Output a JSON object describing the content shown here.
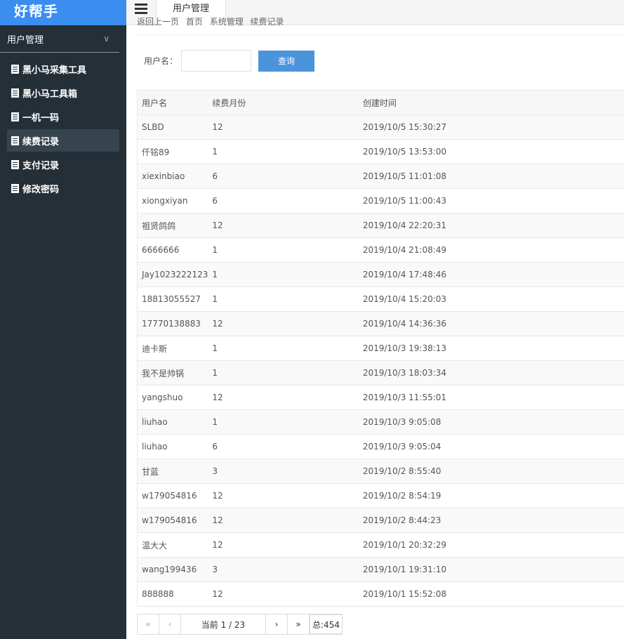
{
  "app": {
    "brand": "好帮手"
  },
  "sidebar": {
    "section_title": "用户管理",
    "items": [
      {
        "label": "黑小马采集工具",
        "active": false
      },
      {
        "label": "黑小马工具箱",
        "active": false
      },
      {
        "label": "一机一码",
        "active": false
      },
      {
        "label": "续费记录",
        "active": true
      },
      {
        "label": "支付记录",
        "active": false
      },
      {
        "label": "修改密码",
        "active": false
      }
    ]
  },
  "topbar": {
    "tab_label": "用户管理"
  },
  "breadcrumb": [
    "返回上一页",
    "首页",
    "系统管理",
    "续费记录"
  ],
  "search": {
    "label": "用户名：",
    "value": "",
    "placeholder": "",
    "button_label": "查询"
  },
  "table": {
    "headers": [
      "用户名",
      "续费月份",
      "创建时间"
    ],
    "rows": [
      [
        "SLBD",
        "12",
        "2019/10/5 15:30:27"
      ],
      [
        "仟铭89",
        "1",
        "2019/10/5 13:53:00"
      ],
      [
        "xiexinbiao",
        "6",
        "2019/10/5 11:01:08"
      ],
      [
        "xiongxiyan",
        "6",
        "2019/10/5 11:00:43"
      ],
      [
        "祖贤鸽鸽",
        "12",
        "2019/10/4 22:20:31"
      ],
      [
        "6666666",
        "1",
        "2019/10/4 21:08:49"
      ],
      [
        "Jay1023222123",
        "1",
        "2019/10/4 17:48:46"
      ],
      [
        "18813055527",
        "1",
        "2019/10/4 15:20:03"
      ],
      [
        "17770138883",
        "12",
        "2019/10/4 14:36:36"
      ],
      [
        "迪卡斯",
        "1",
        "2019/10/3 19:38:13"
      ],
      [
        "我不是帅锅",
        "1",
        "2019/10/3 18:03:34"
      ],
      [
        "yangshuo",
        "12",
        "2019/10/3 11:55:01"
      ],
      [
        "liuhao",
        "1",
        "2019/10/3 9:05:08"
      ],
      [
        "liuhao",
        "6",
        "2019/10/3 9:05:04"
      ],
      [
        "甘蓝",
        "3",
        "2019/10/2 8:55:40"
      ],
      [
        "w179054816",
        "12",
        "2019/10/2 8:54:19"
      ],
      [
        "w179054816",
        "12",
        "2019/10/2 8:44:23"
      ],
      [
        "温大大",
        "12",
        "2019/10/1 20:32:29"
      ],
      [
        "wang199436",
        "3",
        "2019/10/1 19:31:10"
      ],
      [
        "888888",
        "12",
        "2019/10/1 15:52:08"
      ]
    ]
  },
  "pagination": {
    "first": "«",
    "prev": "‹",
    "current_text": "当前  1 / 23",
    "next": "›",
    "last": "»",
    "total_text": "总:454"
  }
}
